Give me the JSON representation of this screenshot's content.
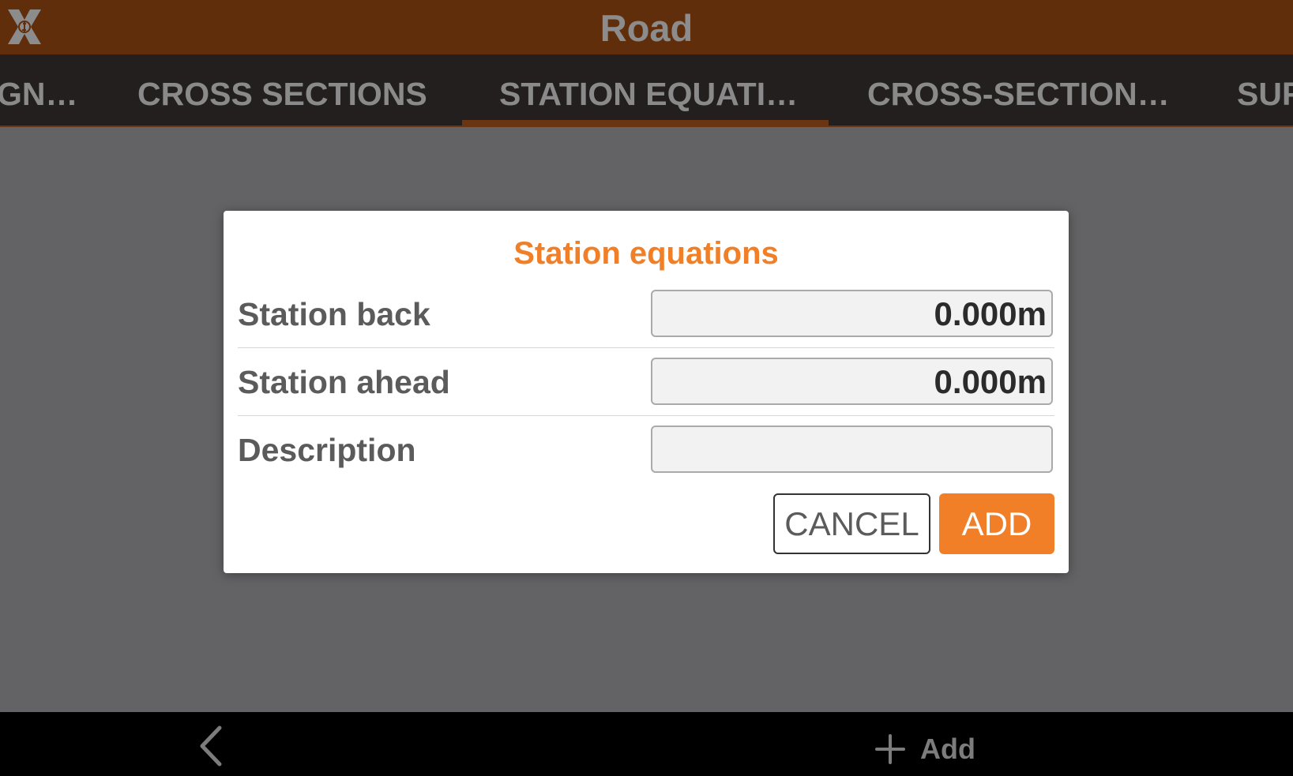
{
  "header": {
    "title": "Road",
    "logo_icon": "x-logo-icon"
  },
  "tabs": [
    {
      "label": "GN…",
      "active": false
    },
    {
      "label": "CROSS SECTIONS",
      "active": false
    },
    {
      "label": "STATION EQUATI…",
      "active": true
    },
    {
      "label": "CROSS-SECTION…",
      "active": false
    },
    {
      "label": "SUF",
      "active": false
    }
  ],
  "dialog": {
    "title": "Station equations",
    "rows": [
      {
        "label": "Station back",
        "value": "0.000m"
      },
      {
        "label": "Station ahead",
        "value": "0.000m"
      },
      {
        "label": "Description",
        "value": ""
      }
    ],
    "cancel_label": "CANCEL",
    "add_label": "ADD"
  },
  "bottom_bar": {
    "back_icon": "chevron-left-icon",
    "add_icon": "plus-icon",
    "add_label": "Add"
  },
  "colors": {
    "accent": "#f07f28",
    "titlebar": "#612e0c",
    "tabbar": "#231f1f",
    "overlay": "#636365"
  }
}
